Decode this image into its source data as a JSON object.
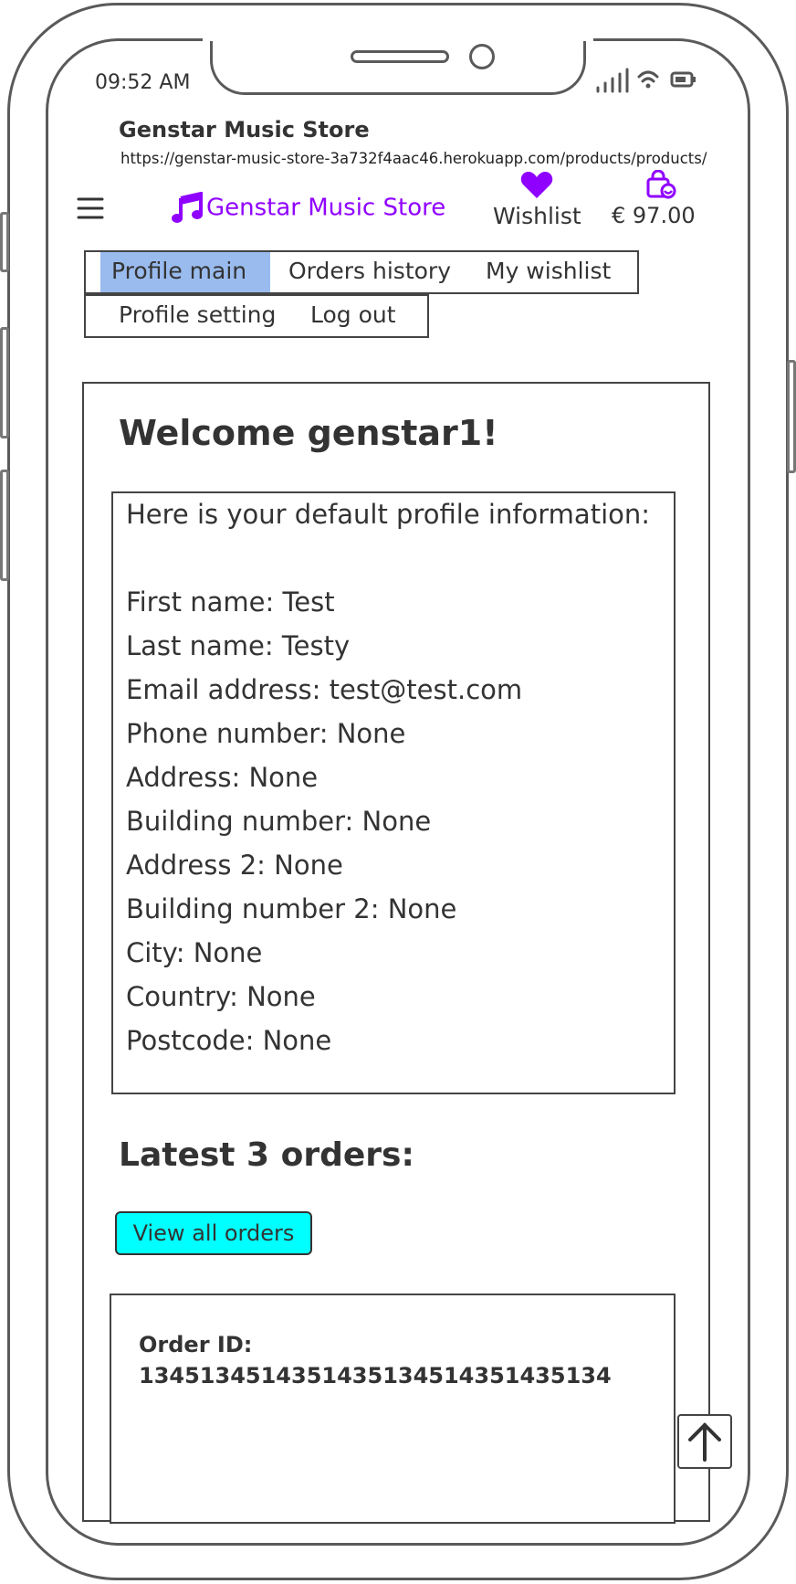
{
  "status_bar": {
    "time": "09:52 AM"
  },
  "browser": {
    "title": "Genstar Music Store",
    "url": "https://genstar-music-store-3a732f4aac46.herokuapp.com/products/products/"
  },
  "header": {
    "menu_icon": "hamburger-menu-icon",
    "brand": "Genstar Music Store",
    "brand_color": "#8f00ff",
    "wishlist_label": "Wishlist",
    "cart_total": "€ 97.00"
  },
  "tabs": {
    "row1": [
      "Profile main",
      "Orders history",
      "My wishlist"
    ],
    "row2": [
      "Profile setting",
      "Log out"
    ],
    "active": "Profile main",
    "active_color": "#99bbee"
  },
  "main": {
    "welcome": "Welcome genstar1!",
    "intro": "Here is your default profile information:",
    "profile_lines": [
      "First name: Test",
      "Last name: Testy",
      "Email address: test@test.com",
      "Phone number: None",
      "Address: None",
      "Building number: None",
      "Address 2: None",
      "Building number 2: None",
      "City: None",
      "Country: None",
      "Postcode: None"
    ],
    "orders_heading": "Latest 3 orders:",
    "view_all_label": "View all orders",
    "view_all_color": "#00ffff",
    "order": {
      "label": "Order ID:",
      "id": "134513451435143513451435143513​4"
    }
  }
}
